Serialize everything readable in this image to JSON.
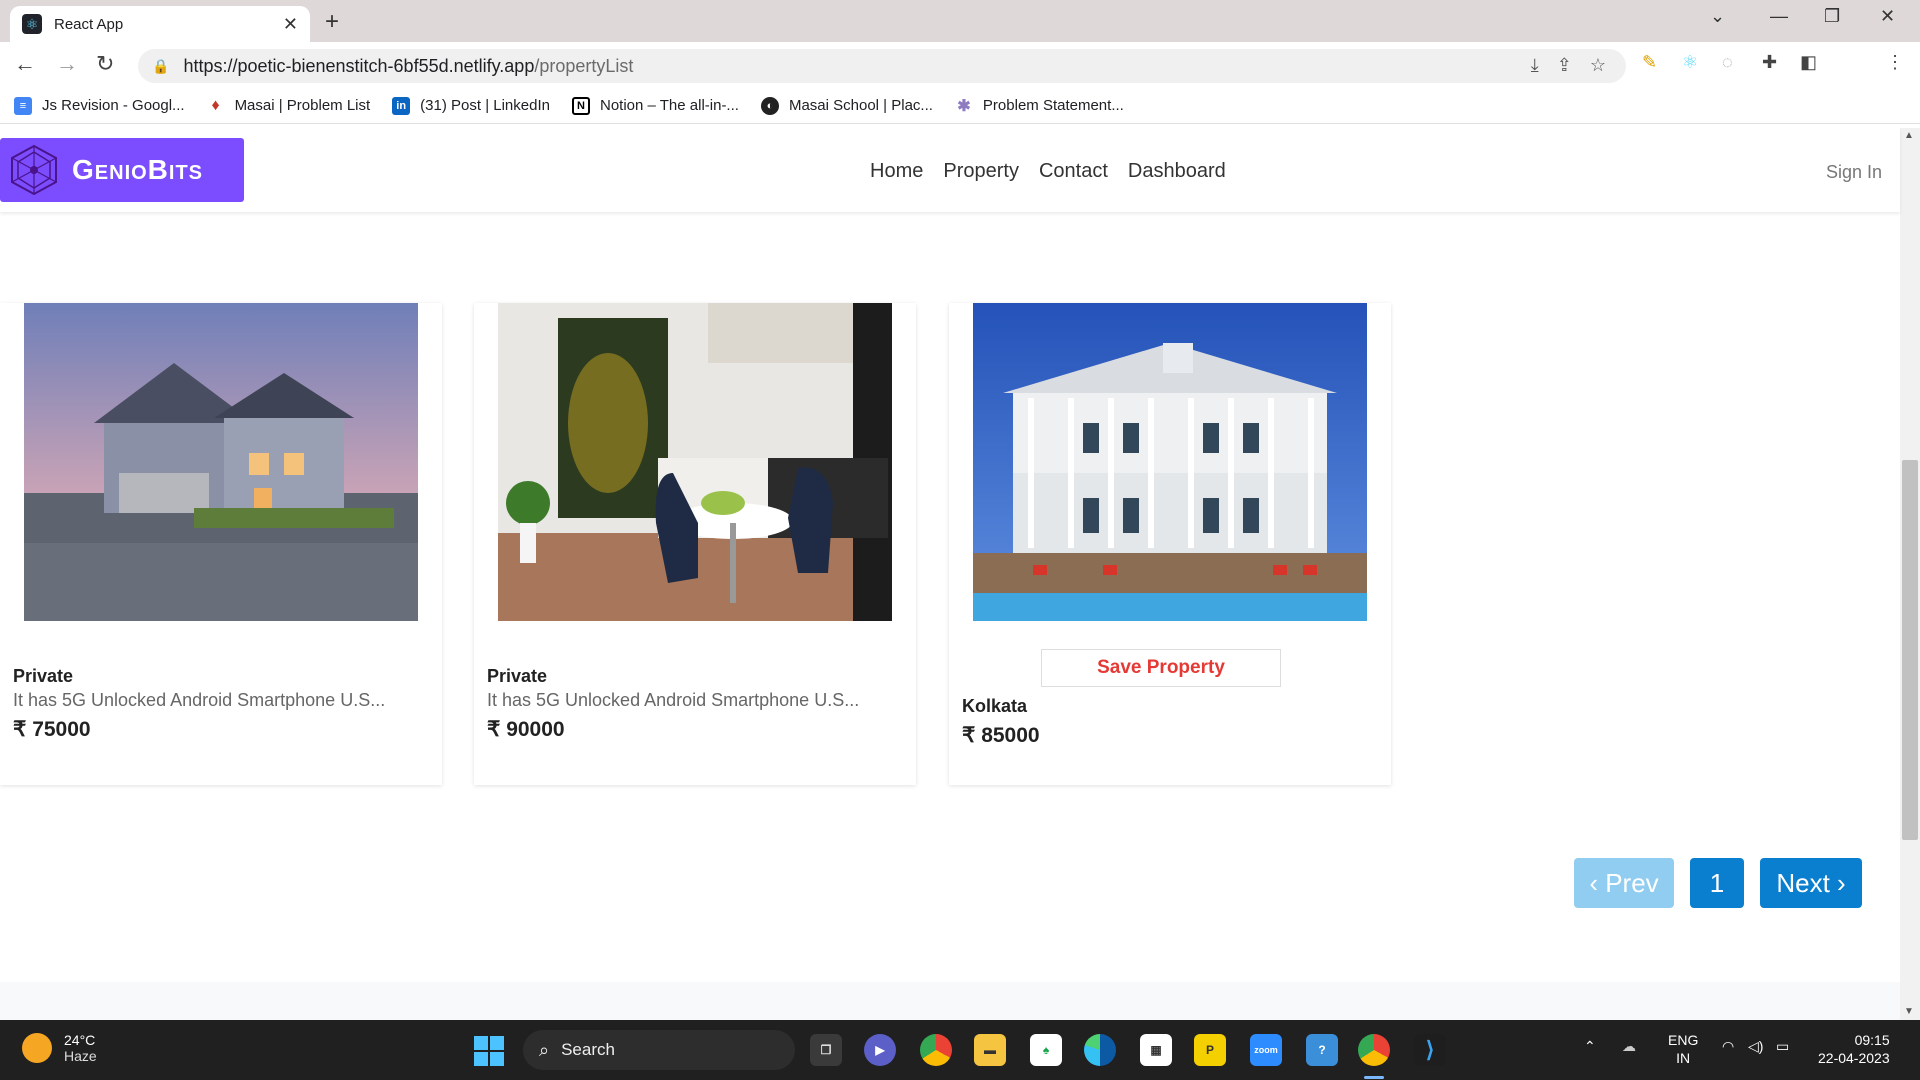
{
  "browser": {
    "tab_title": "React App",
    "tab_close": "✕",
    "new_tab": "+",
    "url_host": "https://poetic-bienenstitch-6bf55d.netlify.app",
    "url_path": "/propertyList",
    "bookmarks": [
      {
        "label": "Js Revision - Googl...",
        "color": "#4285f4",
        "glyph": "≡"
      },
      {
        "label": "Masai | Problem List",
        "color": "#c0392b",
        "glyph": "♦"
      },
      {
        "label": "(31) Post | LinkedIn",
        "color": "#0a66c2",
        "glyph": "in"
      },
      {
        "label": "Notion – The all-in-...",
        "color": "#000000",
        "glyph": "N"
      },
      {
        "label": "Masai School | Plac...",
        "color": "#222222",
        "glyph": "◐"
      },
      {
        "label": "Problem Statement...",
        "color": "#8e7cc3",
        "glyph": "✱"
      }
    ]
  },
  "site": {
    "logo_text": "GenioBits",
    "nav": [
      "Home",
      "Property",
      "Contact",
      "Dashboard"
    ],
    "sign_in": "Sign In",
    "accent": "#7c4dff"
  },
  "cards": [
    {
      "type": "Private",
      "description": "It has 5G Unlocked Android Smartphone U.S...",
      "price": "₹ 75000"
    },
    {
      "type": "Private",
      "description": "It has 5G Unlocked Android Smartphone U.S...",
      "price": "₹ 90000"
    },
    {
      "save_label": "Save Property",
      "location": "Kolkata",
      "price": "₹ 85000"
    }
  ],
  "pagination": {
    "prev": "‹ Prev",
    "current": "1",
    "next": "Next ›"
  },
  "taskbar": {
    "temperature": "24°C",
    "condition": "Haze",
    "search": "Search",
    "lang_top": "ENG",
    "lang_bottom": "IN",
    "time": "09:15",
    "date": "22-04-2023"
  }
}
